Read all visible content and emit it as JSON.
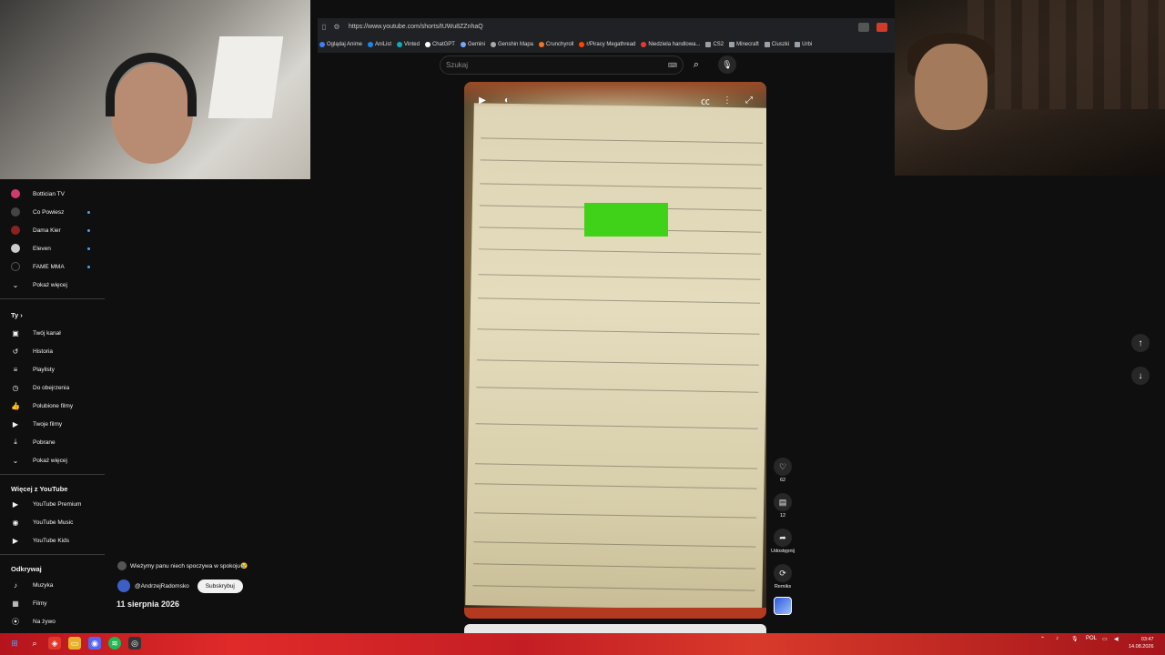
{
  "browser": {
    "url": "https://www.youtube.com/shorts/tUWu8ZZnhaQ",
    "bookmarks": [
      "Oglądaj Anime",
      "AniList",
      "Vinted",
      "ChatGPT",
      "Gemini",
      "Genshin Mapa",
      "Crunchyroll",
      "r/Piracy Megathread",
      "Niedziela handlowa...",
      "CS2",
      "Minecraft",
      "Ciuszki",
      "Urbi"
    ]
  },
  "search": {
    "placeholder": "Szukaj"
  },
  "sidebar": {
    "subscriptions": [
      {
        "label": "Bottician TV",
        "live": false,
        "color": "#d23a6a"
      },
      {
        "label": "Co Powiesz",
        "live": true,
        "color": "#444444"
      },
      {
        "label": "Dama Kier",
        "live": true,
        "color": "#8b2222"
      },
      {
        "label": "Eleven",
        "live": true,
        "color": "#cccccc"
      },
      {
        "label": "FAME MMA",
        "live": true,
        "color": "#111111"
      }
    ],
    "show_more": "Pokaż więcej",
    "you_heading": "Ty",
    "you_items": [
      {
        "label": "Twój kanał",
        "icon": "channel-icon",
        "glyph": "▣"
      },
      {
        "label": "Historia",
        "icon": "history-icon",
        "glyph": "↺"
      },
      {
        "label": "Playlisty",
        "icon": "playlists-icon",
        "glyph": "≡"
      },
      {
        "label": "Do obejrzenia",
        "icon": "watch-later-icon",
        "glyph": "◷"
      },
      {
        "label": "Polubione filmy",
        "icon": "thumb-up-icon",
        "glyph": "☝"
      },
      {
        "label": "Twoje filmy",
        "icon": "your-videos-icon",
        "glyph": "▶"
      },
      {
        "label": "Pobrane",
        "icon": "download-icon",
        "glyph": "⤓"
      }
    ],
    "show_more_2": "Pokaż więcej",
    "more_heading": "Więcej z YouTube",
    "more_items": [
      "YouTube Premium",
      "YouTube Music",
      "YouTube Kids"
    ],
    "explore_heading": "Odkrywaj",
    "explore_items": [
      {
        "label": "Muzyka",
        "icon": "music-icon",
        "glyph": "♪"
      },
      {
        "label": "Filmy",
        "icon": "film-icon",
        "glyph": "▦"
      },
      {
        "label": "Na żywo",
        "icon": "live-icon",
        "glyph": "((•))"
      }
    ]
  },
  "short": {
    "likes": "62",
    "comments": "12",
    "share_label": "Udostępnij",
    "remix_label": "Remiks",
    "pinned_text": "Wieżymy panu niech spoczywa w spokoju😢",
    "channel": "@AndrzejRadomsko",
    "subscribe_label": "Subskrybuj",
    "date": "11 sierpnia 2026"
  },
  "taskbar": {
    "lang": "POL",
    "time": "03:47",
    "date": "14.08.2026"
  },
  "colors": {
    "yt_red": "#ff0033",
    "green_box": "#3fd218",
    "taskbar": "#c41e24"
  }
}
